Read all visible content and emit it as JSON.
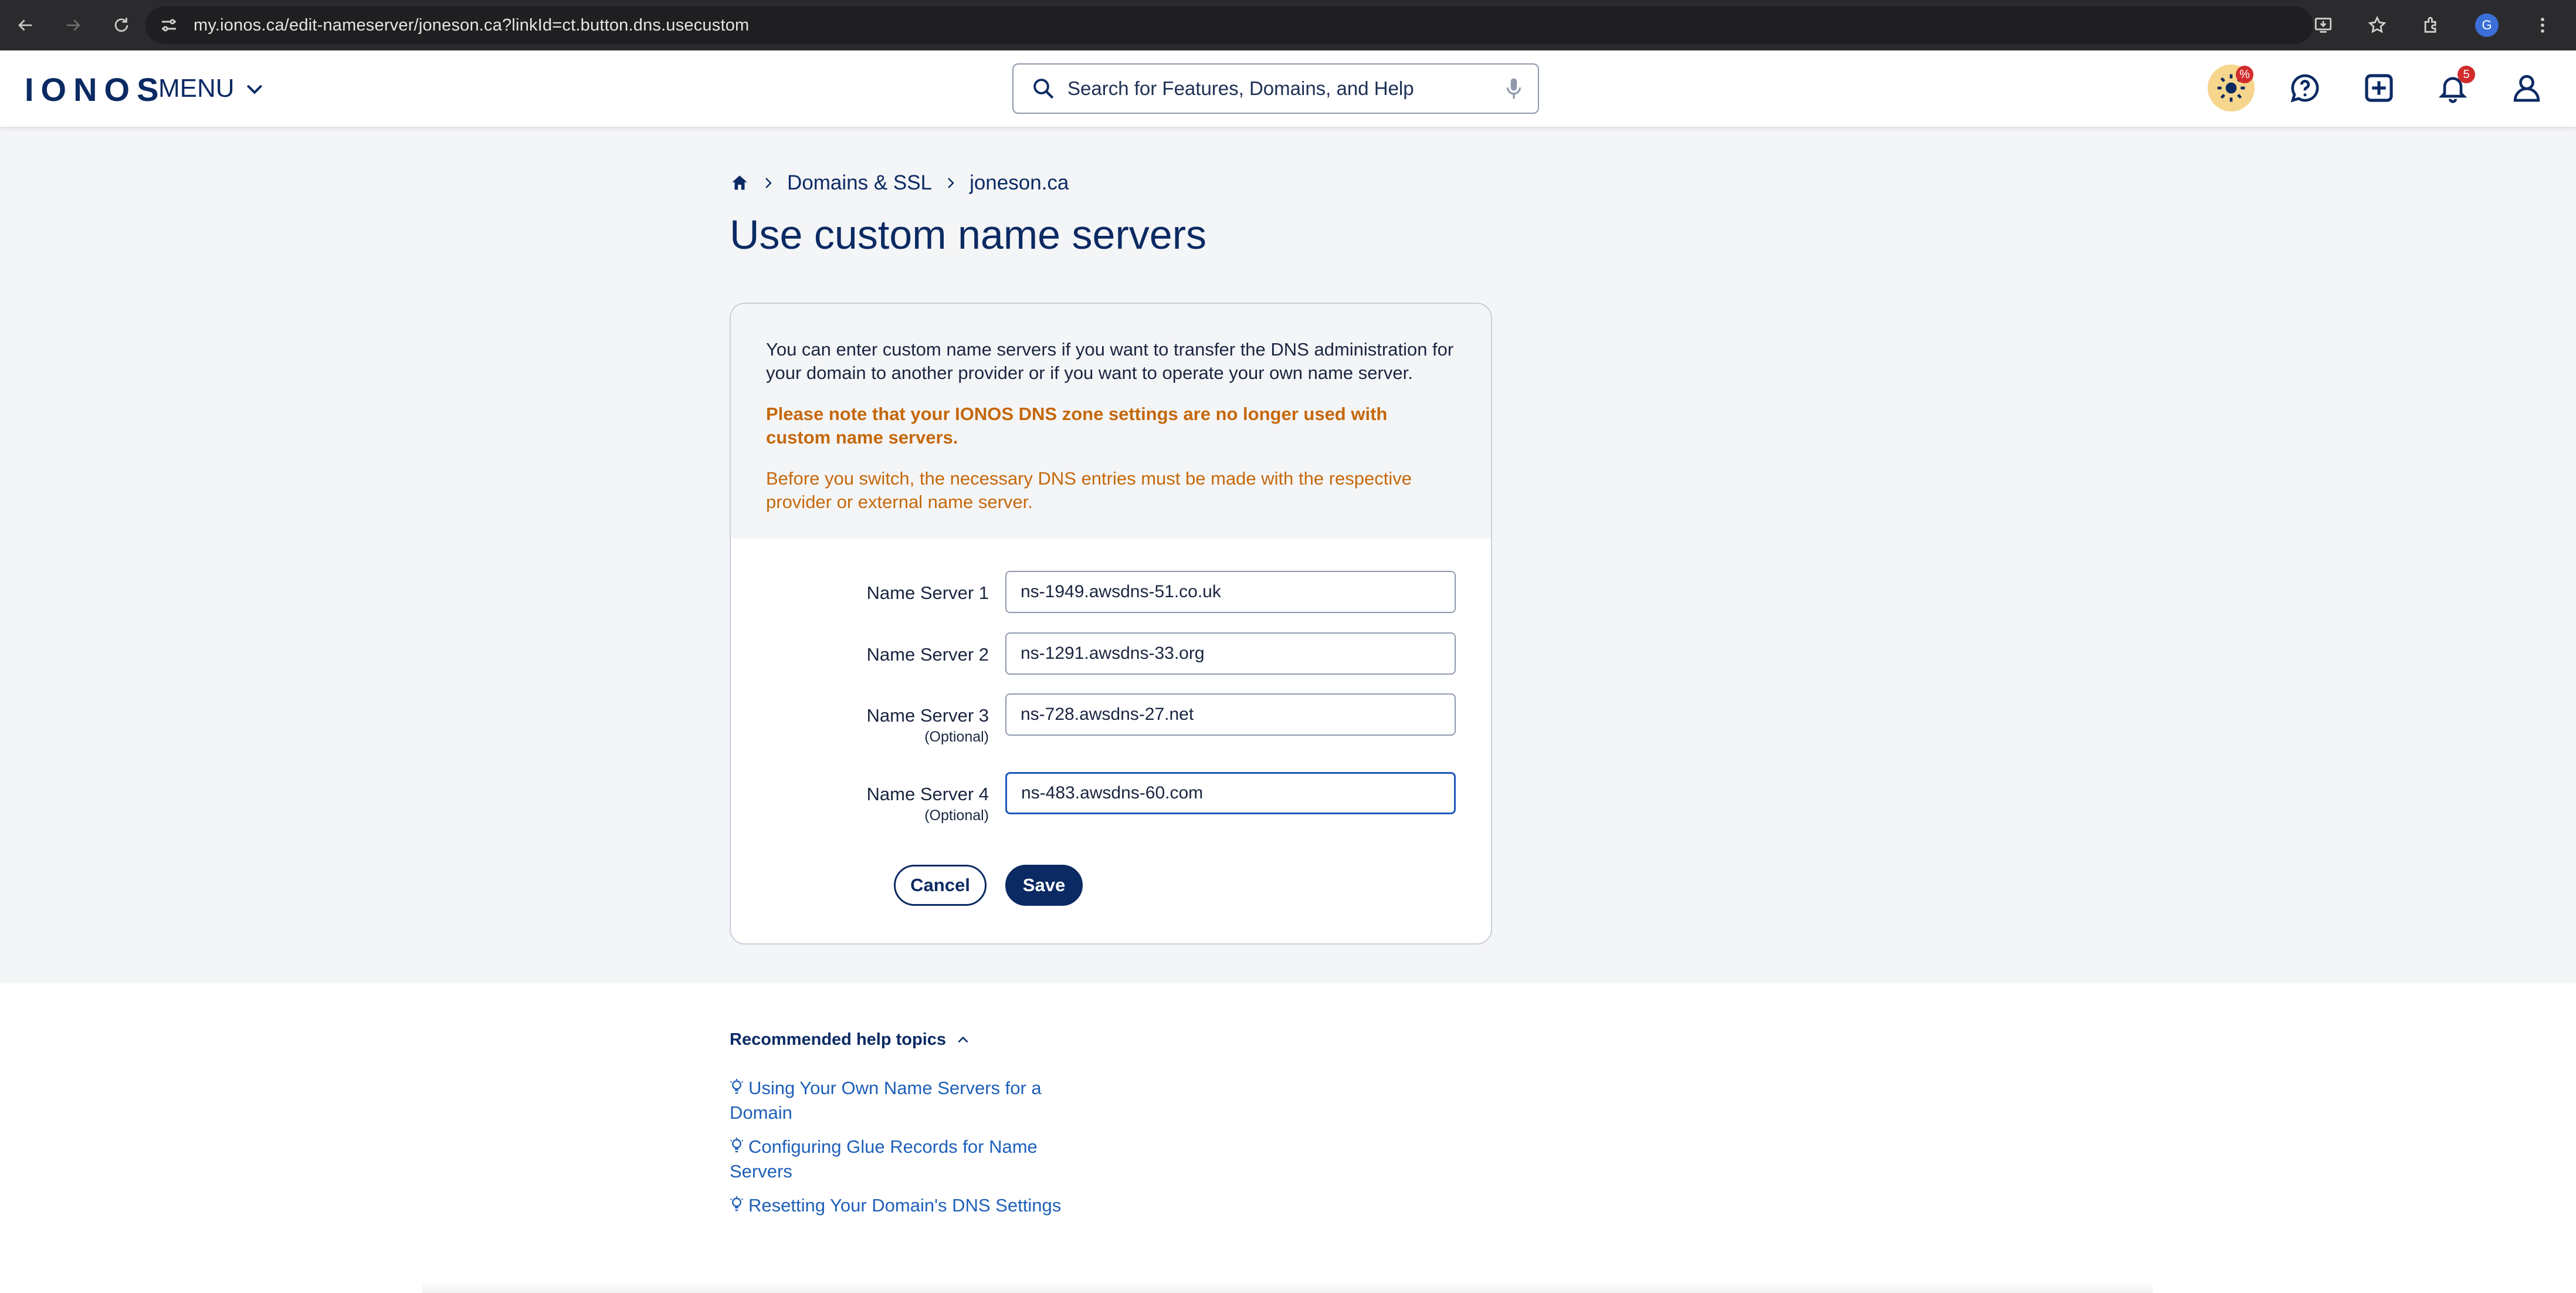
{
  "browser": {
    "url": "my.ionos.ca/edit-nameserver/joneson.ca?linkId=ct.button.dns.usecustom",
    "profile_initial": "G"
  },
  "header": {
    "logo": "IONOS",
    "menu_label": "MENU",
    "search_placeholder": "Search for Features, Domains, and Help",
    "promo_badge": "%",
    "notifications_count": "5"
  },
  "breadcrumb": {
    "items": [
      "Domains & SSL",
      "joneson.ca"
    ]
  },
  "page_title": "Use custom name servers",
  "info": {
    "text": "You can enter custom name servers if you want to transfer the DNS administration for your domain to another provider or if you want to operate your own name server.",
    "warning": "Please note that your IONOS DNS zone settings are no longer used with custom name servers.",
    "note": "Before you switch, the necessary DNS entries must be made with the respective provider or external name server."
  },
  "name_servers": [
    {
      "label": "Name Server 1",
      "optional": "",
      "value": "ns-1949.awsdns-51.co.uk"
    },
    {
      "label": "Name Server 2",
      "optional": "",
      "value": "ns-1291.awsdns-33.org"
    },
    {
      "label": "Name Server 3",
      "optional": "(Optional)",
      "value": "ns-728.awsdns-27.net"
    },
    {
      "label": "Name Server 4",
      "optional": "(Optional)",
      "value": "ns-483.awsdns-60.com"
    }
  ],
  "buttons": {
    "cancel": "Cancel",
    "save": "Save"
  },
  "help": {
    "title": "Recommended help topics",
    "links": [
      "Using Your Own Name Servers for a Domain",
      "Configuring Glue Records for Name Servers",
      "Resetting Your Domain's DNS Settings"
    ]
  },
  "colors": {
    "brand": "#0b2a63",
    "warning": "#c5680b",
    "link": "#1e5fb8",
    "badge": "#d12d2d"
  }
}
